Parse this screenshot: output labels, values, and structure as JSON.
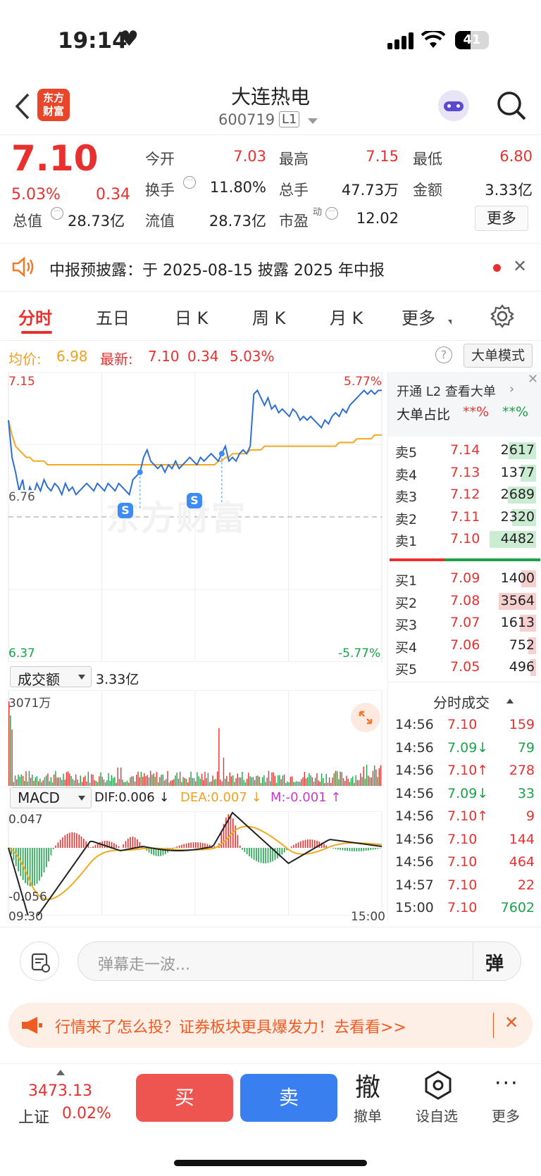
{
  "status": {
    "time": "19:14",
    "battery": "41"
  },
  "header": {
    "logo": "东方\n财富",
    "title": "大连热电",
    "code": "600719",
    "level": "L1"
  },
  "quote": {
    "price": "7.10",
    "pct": "5.03%",
    "chg": "0.34",
    "fields": [
      {
        "label": "今开",
        "value": "7.03",
        "color": "red"
      },
      {
        "label": "最高",
        "value": "7.15",
        "color": "red"
      },
      {
        "label": "最低",
        "value": "6.80",
        "color": "red"
      },
      {
        "label": "换手",
        "value": "11.80%",
        "color": "dark"
      },
      {
        "label": "总手",
        "value": "47.73万",
        "color": "dark"
      },
      {
        "label": "金额",
        "value": "3.33亿",
        "color": "dark"
      },
      {
        "label": "总值",
        "value": "28.73亿",
        "color": "dark"
      },
      {
        "label": "流值",
        "value": "28.73亿",
        "color": "dark"
      },
      {
        "label": "市盈",
        "value": "12.02",
        "color": "dark"
      }
    ],
    "more": "更多",
    "pe_sup": "动"
  },
  "notice": {
    "text": "中报预披露：于 2025-08-15 披露 2025 年中报"
  },
  "tabs": [
    "分时",
    "五日",
    "日 K",
    "周 K",
    "月 K",
    "更多"
  ],
  "info": {
    "avg_label": "均价:",
    "avg": "6.98",
    "latest_label": "最新:",
    "latest": "7.10",
    "chg": "0.34",
    "pct": "5.03%",
    "mode": "大单模式"
  },
  "chart": {
    "top": "7.15",
    "top_pct": "5.77%",
    "mid": "6.76",
    "bottom": "6.37",
    "bottom_pct": "-5.77%",
    "watermark": "东方财富",
    "s_marker": "S"
  },
  "chart_data": {
    "type": "line",
    "x_start": "09:30",
    "x_end": "15:00",
    "ylim": [
      6.37,
      7.15
    ],
    "prev_close": 6.76,
    "price": [
      7.02,
      6.92,
      6.88,
      6.83,
      6.86,
      6.8,
      6.84,
      6.82,
      6.85,
      6.83,
      6.86,
      6.84,
      6.83,
      6.85,
      6.84,
      6.82,
      6.85,
      6.83,
      6.84,
      6.82,
      6.83,
      6.84,
      6.85,
      6.84,
      6.83,
      6.85,
      6.84,
      6.83,
      6.85,
      6.84,
      6.83,
      6.85,
      6.84,
      6.83,
      6.82,
      6.86,
      6.87,
      6.88,
      6.92,
      6.94,
      6.91,
      6.9,
      6.89,
      6.9,
      6.88,
      6.9,
      6.89,
      6.91,
      6.89,
      6.9,
      6.91,
      6.92,
      6.91,
      6.9,
      6.92,
      6.91,
      6.92,
      6.93,
      6.92,
      6.91,
      6.93,
      6.95,
      6.91,
      6.92,
      6.91,
      6.93,
      6.94,
      6.93,
      6.95,
      7.09,
      7.1,
      7.08,
      7.06,
      7.08,
      7.05,
      7.06,
      7.04,
      7.05,
      7.04,
      7.03,
      7.05,
      7.04,
      7.02,
      7.03,
      7.02,
      7.03,
      7.02,
      7.01,
      7.0,
      7.02,
      7.01,
      7.03,
      7.04,
      7.03,
      7.05,
      7.04,
      7.06,
      7.07,
      7.08,
      7.09,
      7.1,
      7.09,
      7.1,
      7.09,
      7.1,
      7.1
    ],
    "avg": [
      7.02,
      6.98,
      6.95,
      6.94,
      6.93,
      6.92,
      6.92,
      6.91,
      6.91,
      6.91,
      6.91,
      6.9,
      6.9,
      6.9,
      6.9,
      6.9,
      6.9,
      6.9,
      6.9,
      6.9,
      6.9,
      6.9,
      6.9,
      6.9,
      6.9,
      6.9,
      6.9,
      6.9,
      6.9,
      6.9,
      6.9,
      6.9,
      6.9,
      6.9,
      6.9,
      6.9,
      6.9,
      6.9,
      6.9,
      6.9,
      6.9,
      6.9,
      6.9,
      6.9,
      6.9,
      6.9,
      6.9,
      6.9,
      6.9,
      6.9,
      6.9,
      6.9,
      6.9,
      6.9,
      6.9,
      6.9,
      6.9,
      6.9,
      6.9,
      6.91,
      6.91,
      6.92,
      6.92,
      6.93,
      6.93,
      6.93,
      6.93,
      6.93,
      6.94,
      6.94,
      6.94,
      6.94,
      6.95,
      6.95,
      6.95,
      6.95,
      6.95,
      6.95,
      6.95,
      6.95,
      6.95,
      6.95,
      6.95,
      6.95,
      6.95,
      6.95,
      6.95,
      6.95,
      6.95,
      6.95,
      6.95,
      6.95,
      6.95,
      6.96,
      6.96,
      6.96,
      6.96,
      6.96,
      6.97,
      6.97,
      6.97,
      6.97,
      6.97,
      6.98,
      6.98,
      6.98
    ]
  },
  "volume": {
    "label": "成交额",
    "total": "3.33亿",
    "max": "3071万"
  },
  "macd": {
    "label": "MACD",
    "dif": "DIF:0.006 ↓",
    "dea": "DEA:0.007 ↓",
    "m": "M:-0.001 ↑",
    "top": "0.047",
    "bottom": "-0.056",
    "t0": "09:30",
    "t1": "15:00"
  },
  "l2": {
    "title": "开通 L2 查看大单",
    "ratio_label": "大单占比",
    "r1": "**%",
    "r2": "**%"
  },
  "asks": [
    {
      "l": "卖5",
      "p": "7.14",
      "v": "2617",
      "f": 0.35
    },
    {
      "l": "卖4",
      "p": "7.13",
      "v": "1377",
      "f": 0.2
    },
    {
      "l": "卖3",
      "p": "7.12",
      "v": "2689",
      "f": 0.36
    },
    {
      "l": "卖2",
      "p": "7.11",
      "v": "2320",
      "f": 0.31
    },
    {
      "l": "卖1",
      "p": "7.10",
      "v": "4482",
      "f": 0.6
    }
  ],
  "bids": [
    {
      "l": "买1",
      "p": "7.09",
      "v": "1400",
      "f": 0.19
    },
    {
      "l": "买2",
      "p": "7.08",
      "v": "3564",
      "f": 0.48
    },
    {
      "l": "买3",
      "p": "7.07",
      "v": "1613",
      "f": 0.21
    },
    {
      "l": "买4",
      "p": "7.06",
      "v": "752",
      "f": 0.1
    },
    {
      "l": "买5",
      "p": "7.05",
      "v": "496",
      "f": 0.07
    }
  ],
  "ticks_title": "分时成交",
  "ticks": [
    {
      "t": "14:56",
      "p": "7.10",
      "a": "",
      "v": "159",
      "c": "red"
    },
    {
      "t": "14:56",
      "p": "7.09",
      "a": "↓",
      "v": "79",
      "c": "green"
    },
    {
      "t": "14:56",
      "p": "7.10",
      "a": "↑",
      "v": "278",
      "c": "red"
    },
    {
      "t": "14:56",
      "p": "7.09",
      "a": "↓",
      "v": "33",
      "c": "green"
    },
    {
      "t": "14:56",
      "p": "7.10",
      "a": "↑",
      "v": "9",
      "c": "red"
    },
    {
      "t": "14:56",
      "p": "7.10",
      "a": "",
      "v": "144",
      "c": "red"
    },
    {
      "t": "14:56",
      "p": "7.10",
      "a": "",
      "v": "464",
      "c": "red"
    },
    {
      "t": "14:57",
      "p": "7.10",
      "a": "",
      "v": "22",
      "c": "red"
    },
    {
      "t": "15:00",
      "p": "7.10",
      "a": "",
      "v": "7602",
      "c": "green"
    }
  ],
  "comment": {
    "placeholder": "弹幕走一波...",
    "dan": "弹"
  },
  "ad": {
    "text": "行情来了怎么投？证券板块更具爆发力！去看看>>"
  },
  "bottom": {
    "index": "3473.13",
    "index_name": "上证",
    "index_pct": "0.02%",
    "buy": "买",
    "sell": "卖",
    "cancel": "撤单",
    "cancel_big": "撤",
    "watch": "设自选",
    "more": "更多"
  }
}
